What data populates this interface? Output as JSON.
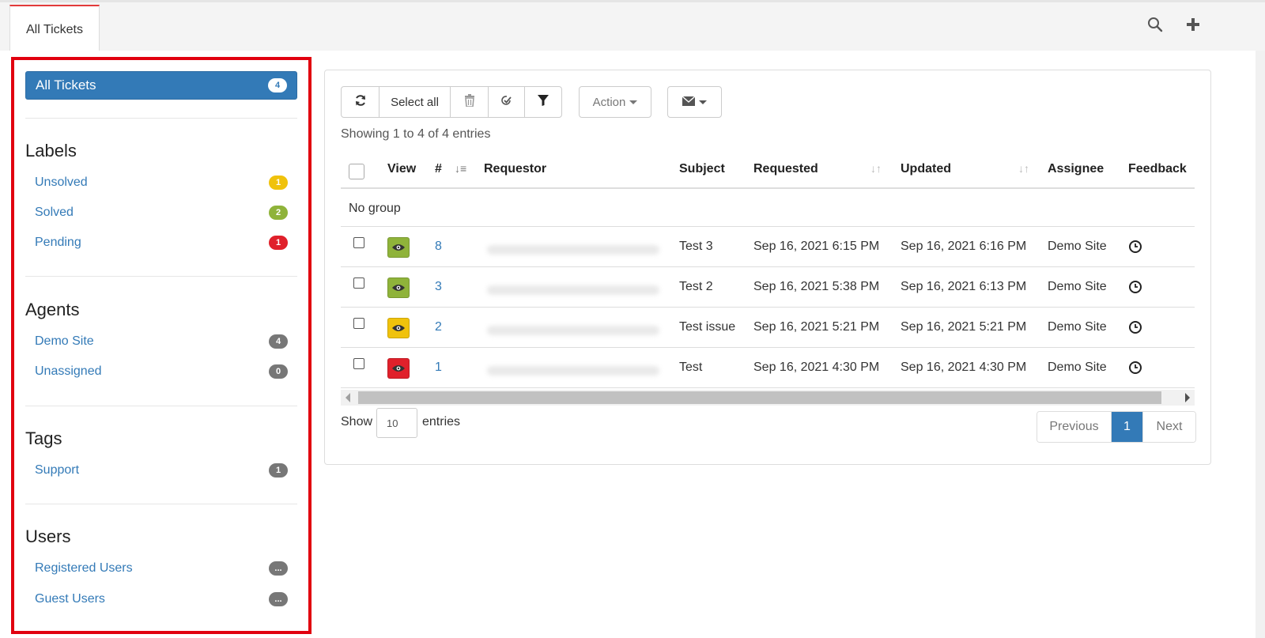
{
  "top_tab": {
    "label": "All Tickets"
  },
  "top_icons": [
    "search-icon",
    "plus-icon"
  ],
  "sidebar": {
    "all_tickets": {
      "label": "All Tickets",
      "count": "4"
    },
    "sections": [
      {
        "heading": "Labels",
        "items": [
          {
            "label": "Unsolved",
            "count": "1",
            "color": "#f0c20c"
          },
          {
            "label": "Solved",
            "count": "2",
            "color": "#8fb33a"
          },
          {
            "label": "Pending",
            "count": "1",
            "color": "#e0202b"
          }
        ]
      },
      {
        "heading": "Agents",
        "items": [
          {
            "label": "Demo Site",
            "count": "4",
            "color": "#777777"
          },
          {
            "label": "Unassigned",
            "count": "0",
            "color": "#777777"
          }
        ]
      },
      {
        "heading": "Tags",
        "items": [
          {
            "label": "Support",
            "count": "1",
            "color": "#777777"
          }
        ]
      },
      {
        "heading": "Users",
        "items": [
          {
            "label": "Registered Users",
            "count": "...",
            "color": "#777777"
          },
          {
            "label": "Guest Users",
            "count": "...",
            "color": "#777777"
          }
        ]
      }
    ]
  },
  "toolbar": {
    "select_all_label": "Select all",
    "action_label": "Action",
    "icons": [
      "refresh-icon",
      "trash-icon",
      "edit-icon",
      "filter-icon",
      "envelope-icon"
    ]
  },
  "table_info": "Showing 1 to 4 of 4 entries",
  "table": {
    "headers": {
      "view": "View",
      "num": "#",
      "requestor": "Requestor",
      "subject": "Subject",
      "requested": "Requested",
      "updated": "Updated",
      "assignee": "Assignee",
      "feedback": "Feedback"
    },
    "group_label": "No group",
    "rows": [
      {
        "id": "8",
        "view_color": "#8fb33a",
        "subject": "Test 3",
        "requested": "Sep 16, 2021 6:15 PM",
        "updated": "Sep 16, 2021 6:16 PM",
        "assignee": "Demo Site"
      },
      {
        "id": "3",
        "view_color": "#8fb33a",
        "subject": "Test 2",
        "requested": "Sep 16, 2021 5:38 PM",
        "updated": "Sep 16, 2021 6:13 PM",
        "assignee": "Demo Site"
      },
      {
        "id": "2",
        "view_color": "#f0c20c",
        "subject": "Test issue",
        "requested": "Sep 16, 2021 5:21 PM",
        "updated": "Sep 16, 2021 5:21 PM",
        "assignee": "Demo Site"
      },
      {
        "id": "1",
        "view_color": "#e0202b",
        "subject": "Test",
        "requested": "Sep 16, 2021 4:30 PM",
        "updated": "Sep 16, 2021 4:30 PM",
        "assignee": "Demo Site"
      }
    ]
  },
  "length": {
    "show_label": "Show",
    "value": "10",
    "entries_label": "entries"
  },
  "pagination": {
    "previous": "Previous",
    "current": "1",
    "next": "Next"
  },
  "colors": {
    "accent": "#337ab7",
    "highlight_border": "#e1000f",
    "tab_accent": "#e23a3a"
  }
}
